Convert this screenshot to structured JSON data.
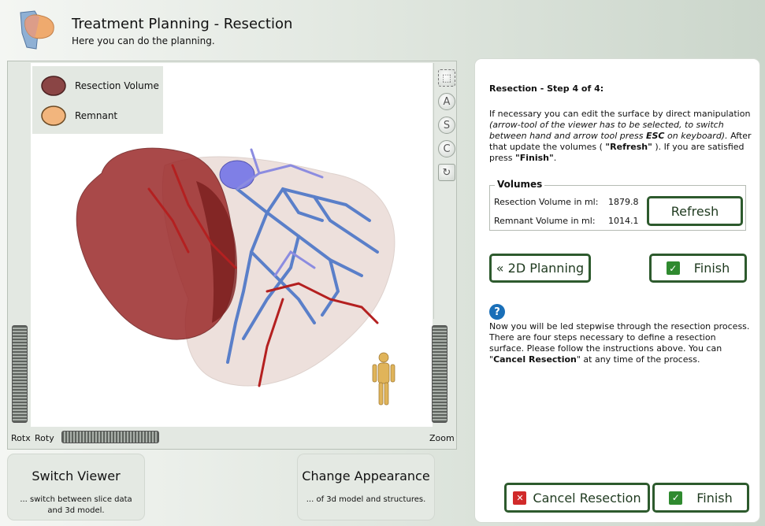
{
  "header": {
    "title": "Treatment Planning - Resection",
    "subtitle": "Here you can do the planning."
  },
  "viewer": {
    "legend": [
      {
        "label": "Resection Volume",
        "color": "#8a4545"
      },
      {
        "label": "Remnant",
        "color": "#f2b57d"
      }
    ],
    "tools": [
      "A",
      "S",
      "C"
    ],
    "rotx_label": "Rotx",
    "roty_label": "Roty",
    "zoom_label": "Zoom"
  },
  "bottom_cards": {
    "switch_viewer": {
      "title": "Switch Viewer",
      "desc": "... switch between slice data and 3d model."
    },
    "change_appearance": {
      "title": "Change Appearance",
      "desc": "... of 3d model and structures."
    }
  },
  "panel": {
    "step_title": "Resection - Step 4 of 4:",
    "instr_1": "If necessary you can edit the surface by direct manipulation ",
    "instr_2": "(arrow-tool of the viewer has to be selected, to switch between hand and arrow tool press ",
    "instr_esc": "ESC",
    "instr_3": " on keyboard).",
    "instr_4": " After that update the volumes ( ",
    "instr_refresh": "\"Refresh\"",
    "instr_5": " ). If you are satisfied press ",
    "instr_finish": "\"Finish\"",
    "instr_6": ".",
    "volumes": {
      "legend": "Volumes",
      "resection_label": "Resection Volume in ml:",
      "resection_value": "1879.8",
      "remnant_label": "Remnant Volume in ml:",
      "remnant_value": "1014.1",
      "refresh_label": "Refresh"
    },
    "planning_2d_label": "« 2D Planning",
    "finish_label": "Finish",
    "help_1": "Now you will be led stepwise through the resection process. There are four steps necessary to define a resection surface. Please follow the instructions above. You can \"",
    "help_cancel": "Cancel Resection",
    "help_2": "\" at any time of the process.",
    "cancel_label": "Cancel Resection",
    "finish_bottom_label": "Finish"
  }
}
